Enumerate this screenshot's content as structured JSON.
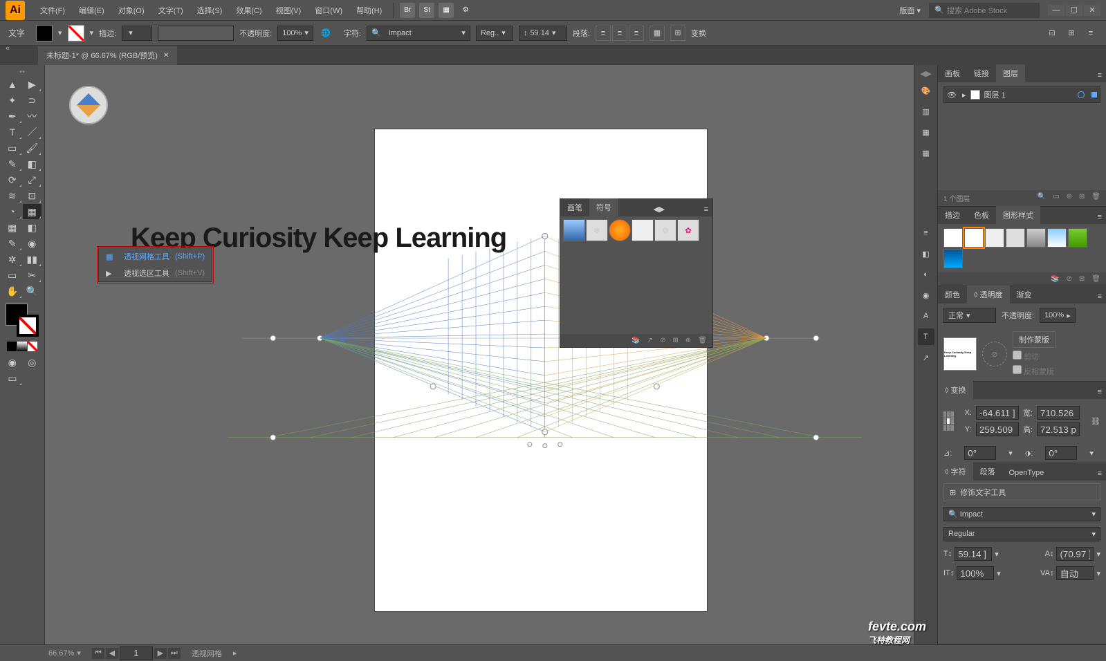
{
  "menubar": {
    "logo": "Ai",
    "items": [
      "文件(F)",
      "编辑(E)",
      "对象(O)",
      "文字(T)",
      "选择(S)",
      "效果(C)",
      "视图(V)",
      "窗口(W)",
      "帮助(H)"
    ],
    "right_icons": [
      "Br",
      "St"
    ],
    "layout_label": "版面",
    "search_placeholder": "搜索 Adobe Stock"
  },
  "controlbar": {
    "type_label": "文字",
    "stroke_label": "描边:",
    "opacity_label": "不透明度:",
    "opacity_value": "100%",
    "char_label": "字符:",
    "font_value": "Impact",
    "font_style": "Reg..",
    "font_size": "59.14",
    "para_label": "段落:",
    "transform_label": "变换"
  },
  "doc_tab": {
    "title": "未标题-1* @ 66.67% (RGB/预览)"
  },
  "flyout": {
    "items": [
      {
        "label": "透视网格工具",
        "shortcut": "(Shift+P)"
      },
      {
        "label": "透视选区工具",
        "shortcut": "(Shift+V)"
      }
    ]
  },
  "canvas_text": "Keep Curiosity Keep Learning",
  "float_panel": {
    "tabs": [
      "画笔",
      "符号"
    ]
  },
  "right": {
    "layers": {
      "tabs": [
        "画板",
        "链接",
        "图层"
      ],
      "layer_name": "图层 1",
      "count": "1 个图层"
    },
    "styles": {
      "tabs": [
        "描边",
        "色板",
        "图形样式"
      ]
    },
    "color_trans": {
      "tabs": [
        "颜色",
        "◊ 透明度",
        "渐变"
      ],
      "blend_mode": "正常",
      "opacity_label": "不透明度:",
      "opacity_value": "100%",
      "make_mask": "制作蒙版",
      "clip": "剪切",
      "invert": "反相蒙版"
    },
    "transform": {
      "title": "◊ 变换",
      "x": "-64.611 ]",
      "y": "259.509 ]",
      "w_label": "宽:",
      "w": "710.526 ]",
      "h_label": "高:",
      "h": "72.513 p:",
      "angle": "0°",
      "shear": "0°"
    },
    "char": {
      "tabs": [
        "◊ 字符",
        "段落",
        "OpenType"
      ],
      "touch_type": "修饰文字工具",
      "font": "Impact",
      "style": "Regular",
      "size": "59.14 ]",
      "leading": "(70.97 ]",
      "tracking": "100%",
      "va": "自动"
    }
  },
  "statusbar": {
    "zoom": "66.67%",
    "page": "1",
    "tool": "透视网格"
  },
  "watermark": {
    "main": "fevte.com",
    "sub": "飞特教程网"
  }
}
